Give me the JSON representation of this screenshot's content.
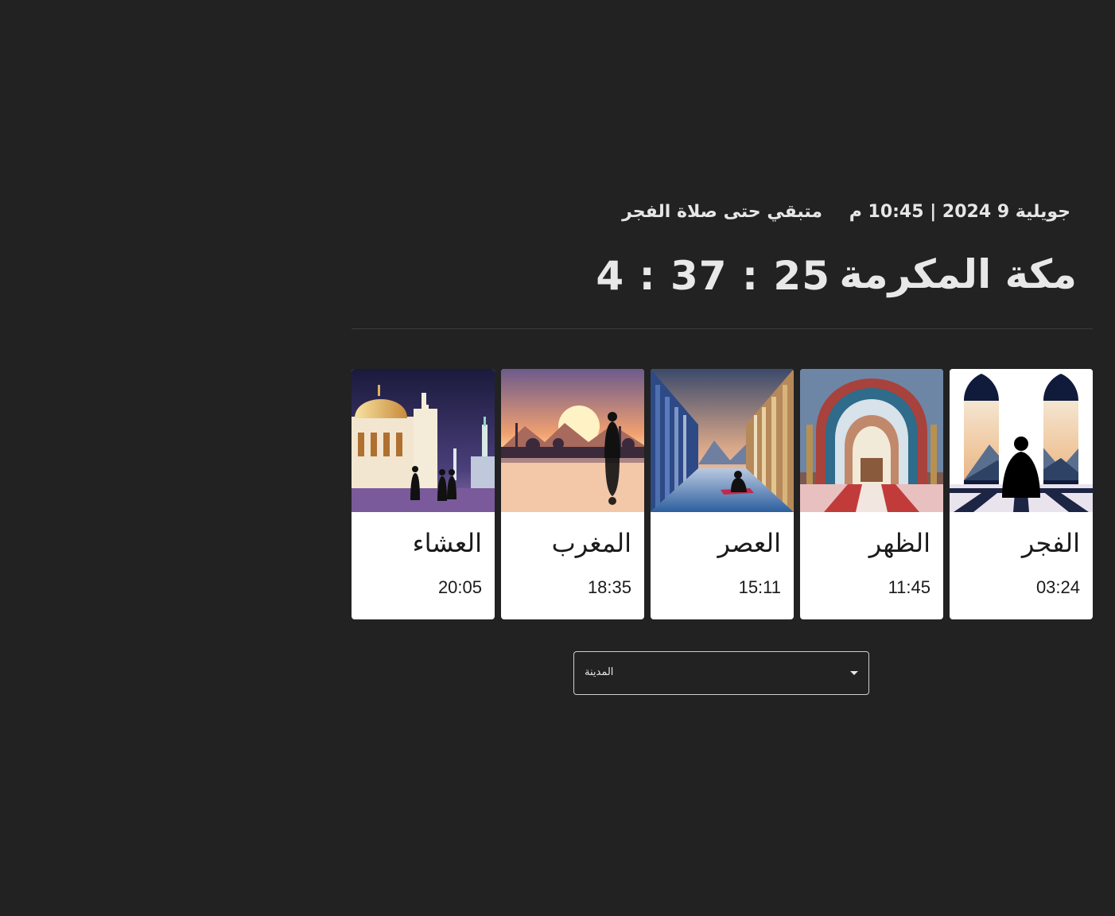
{
  "header": {
    "date_line": "جويلية 9 2024 | 10:45 م",
    "remaining_label": "متبقي حتى صلاة الفجر",
    "city": "مكة المكرمة",
    "countdown": "4 : 37 : 25"
  },
  "prayers": [
    {
      "name": "الفجر",
      "time": "03:24",
      "icon": "fajr-image"
    },
    {
      "name": "الظهر",
      "time": "11:45",
      "icon": "dhuhr-image"
    },
    {
      "name": "العصر",
      "time": "15:11",
      "icon": "asr-image"
    },
    {
      "name": "المغرب",
      "time": "18:35",
      "icon": "maghrib-image"
    },
    {
      "name": "العشاء",
      "time": "20:05",
      "icon": "isha-image"
    }
  ],
  "city_select": {
    "placeholder": "المدينة"
  },
  "colors": {
    "background": "#222222",
    "card_background": "#ffffff",
    "divider": "#3c3c3c"
  }
}
